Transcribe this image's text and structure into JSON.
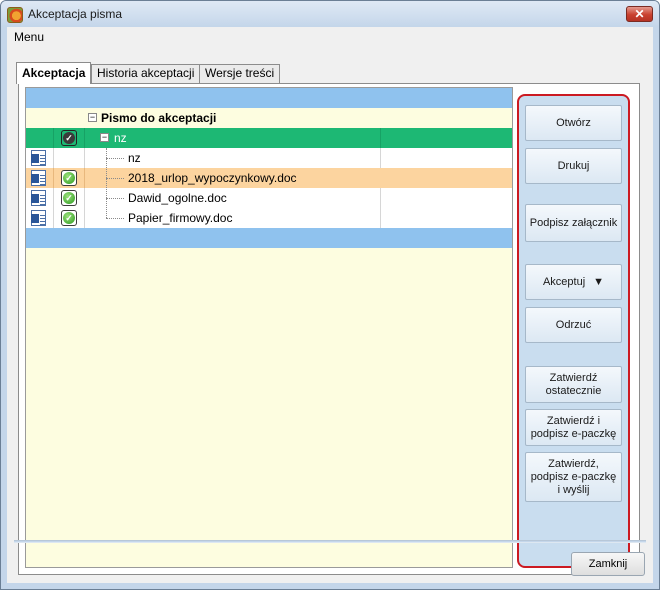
{
  "window": {
    "title": "Akceptacja pisma",
    "close_glyph": "✕"
  },
  "menu": {
    "items": [
      "Menu"
    ]
  },
  "tabs": [
    {
      "label": "Akceptacja",
      "active": true
    },
    {
      "label": "Historia akceptacji",
      "active": false
    },
    {
      "label": "Wersje treści",
      "active": false
    }
  ],
  "tree": {
    "root_label": "Pismo do akceptacji",
    "group_label": "nz",
    "rows": [
      {
        "label": "nz",
        "icon": "word-doc-icon",
        "checked": false,
        "highlight": "none"
      },
      {
        "label": "2018_urlop_wypoczynkowy.doc",
        "icon": "word-doc-icon",
        "checked": true,
        "highlight": "orange"
      },
      {
        "label": "Dawid_ogolne.doc",
        "icon": "word-doc-icon",
        "checked": true,
        "highlight": "none"
      },
      {
        "label": "Papier_firmowy.doc",
        "icon": "word-doc-icon",
        "checked": true,
        "highlight": "none"
      }
    ],
    "expander_glyph": "−",
    "check_glyph": "✓"
  },
  "actions": {
    "open": "Otwórz",
    "print": "Drukuj",
    "sign_attachment": "Podpisz załącznik",
    "accept": "Akceptuj",
    "accept_arrow": "▼",
    "reject": "Odrzuć",
    "approve_final": "Zatwierdź ostatecznie",
    "approve_sign": "Zatwierdź i podpisz e-paczkę",
    "approve_sign_send": "Zatwierdź, podpisz e-paczkę i wyślij"
  },
  "footer": {
    "close_label": "Zamknij"
  },
  "colors": {
    "accent_red": "#cc1a22",
    "group_green": "#1db874",
    "selected_orange": "#fcd49f",
    "header_blue": "#8fc2ee"
  }
}
